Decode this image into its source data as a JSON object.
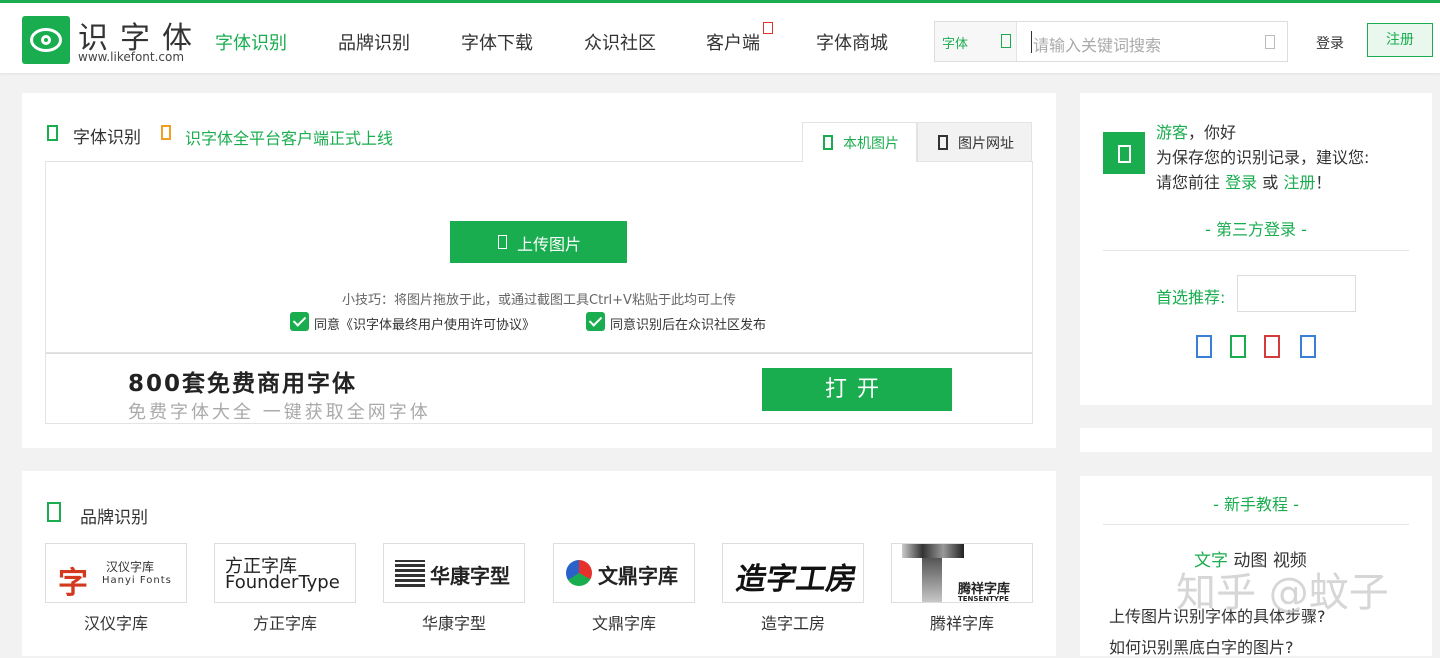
{
  "header": {
    "logo_title": "识字体",
    "logo_sub": "www.likefont.com",
    "nav": [
      {
        "label": "字体识别",
        "active": true
      },
      {
        "label": "品牌识别"
      },
      {
        "label": "字体下载"
      },
      {
        "label": "众识社区"
      },
      {
        "label": "客户端"
      },
      {
        "label": "字体商城"
      }
    ],
    "search": {
      "category": "字体",
      "placeholder": "请输入关键词搜索"
    },
    "login": "登录",
    "register": "注册"
  },
  "recognize": {
    "title": "字体识别",
    "notice": "识字体全平台客户端正式上线",
    "tabs": [
      "本机图片",
      "图片网址"
    ],
    "upload_label": "上传图片",
    "tip": "小技巧：将图片拖放于此，或通过截图工具Ctrl+V粘贴于此均可上传",
    "checks": [
      "同意《识字体最终用户使用许可协议》",
      "同意识别后在众识社区发布"
    ],
    "ad": {
      "title": "800套免费商用字体",
      "subtitle": "免费字体大全 一键获取全网字体",
      "button": "打开"
    }
  },
  "brands": {
    "title": "品牌识别",
    "items": [
      {
        "name": "汉仪字库",
        "logo_cn": "汉仪字库",
        "logo_en": "Hanyi Fonts"
      },
      {
        "name": "方正字库",
        "logo_cn": "方正字库",
        "logo_en": "FounderType"
      },
      {
        "name": "华康字型",
        "logo_cn": "华康字型"
      },
      {
        "name": "文鼎字库",
        "logo_cn": "文鼎字库"
      },
      {
        "name": "造字工房",
        "logo_cn": "造字工房"
      },
      {
        "name": "腾祥字库",
        "logo_cn": "腾祥字库",
        "logo_en": "TENSENTYPE"
      }
    ]
  },
  "sidebar": {
    "guest": "游客",
    "hello": "，你好",
    "line2": "为保存您的识别记录，建议您:",
    "line3_pre": "请您前往",
    "line3_login": "登录",
    "line3_or": "或",
    "line3_register": "注册",
    "line3_end": "！",
    "third_party": "-  第三方登录  -",
    "preferred": "首选推荐:",
    "social_colors": [
      "#3a7fd5",
      "#1aad4f",
      "#d43c3c",
      "#3a7fd5"
    ],
    "tutorial_title": "-  新手教程  -",
    "tutorial_tabs": [
      "文字",
      "动图",
      "视频"
    ],
    "tutorial_items": [
      "上传图片识别字体的具体步骤?",
      "如何识别黑底白字的图片?"
    ]
  },
  "watermark": "知乎 @蚊子",
  "colors": {
    "accent": "#1aad4f",
    "notice_icon": "#f0a020"
  }
}
